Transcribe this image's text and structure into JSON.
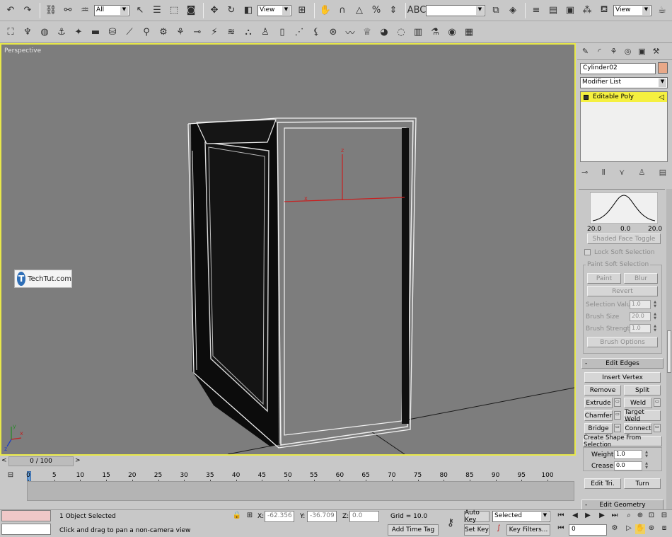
{
  "toolbar": {
    "selection_filter": "All",
    "coord_system": "View",
    "named_selection": "",
    "view_dropdown": "View"
  },
  "viewport": {
    "label": "Perspective",
    "axis_x": "x",
    "axis_y": "y",
    "axis_z": "z",
    "gizmo_x": "x",
    "gizmo_z": "z"
  },
  "watermark": {
    "logo_letter": "T",
    "text": "TechTut.com"
  },
  "command_panel": {
    "object_name": "Cylinder02",
    "object_color": "#e8a888",
    "modifier_list": "Modifier List",
    "stack_item": "Editable Poly",
    "soft_selection": {
      "curve_left": "20.0",
      "curve_mid": "0.0",
      "curve_right": "20.0",
      "shaded_face_toggle": "Shaded Face Toggle",
      "lock_soft_selection": "Lock Soft Selection",
      "paint_group": "Paint Soft Selection",
      "paint": "Paint",
      "blur": "Blur",
      "revert": "Revert",
      "selection_value_label": "Selection Value",
      "selection_value": "1.0",
      "brush_size_label": "Brush Size",
      "brush_size": "20.0",
      "brush_strength_label": "Brush Strength",
      "brush_strength": "1.0",
      "brush_options": "Brush Options"
    },
    "edit_edges": {
      "title": "Edit Edges",
      "collapse": "-",
      "insert_vertex": "Insert Vertex",
      "remove": "Remove",
      "split": "Split",
      "extrude": "Extrude",
      "weld": "Weld",
      "chamfer": "Chamfer",
      "target_weld": "Target Weld",
      "bridge": "Bridge",
      "connect": "Connect",
      "create_shape": "Create Shape From Selection",
      "weight_label": "Weight:",
      "weight": "1.0",
      "crease_label": "Crease:",
      "crease": "0.0",
      "edit_tri": "Edit Tri.",
      "turn": "Turn"
    },
    "edit_geometry": {
      "title": "Edit Geometry",
      "collapse": "-"
    }
  },
  "timeline": {
    "slider_label": "0 / 100",
    "prev": "<",
    "next": ">",
    "ticks": [
      "0",
      "5",
      "10",
      "15",
      "20",
      "25",
      "30",
      "35",
      "40",
      "45",
      "50",
      "55",
      "60",
      "65",
      "70",
      "75",
      "80",
      "85",
      "90",
      "95",
      "100"
    ]
  },
  "status": {
    "selection_info": "1 Object Selected",
    "prompt": "Click and drag to pan a non-camera view",
    "x_label": "X:",
    "x_value": "-62.356",
    "y_label": "Y:",
    "y_value": "-36.709",
    "z_label": "Z:",
    "z_value": "0.0",
    "grid": "Grid = 10.0",
    "add_time_tag": "Add Time Tag",
    "auto_key": "Auto Key",
    "set_key": "Set Key",
    "key_mode": "Selected",
    "key_filters": "Key Filters...",
    "current_frame": "0"
  }
}
